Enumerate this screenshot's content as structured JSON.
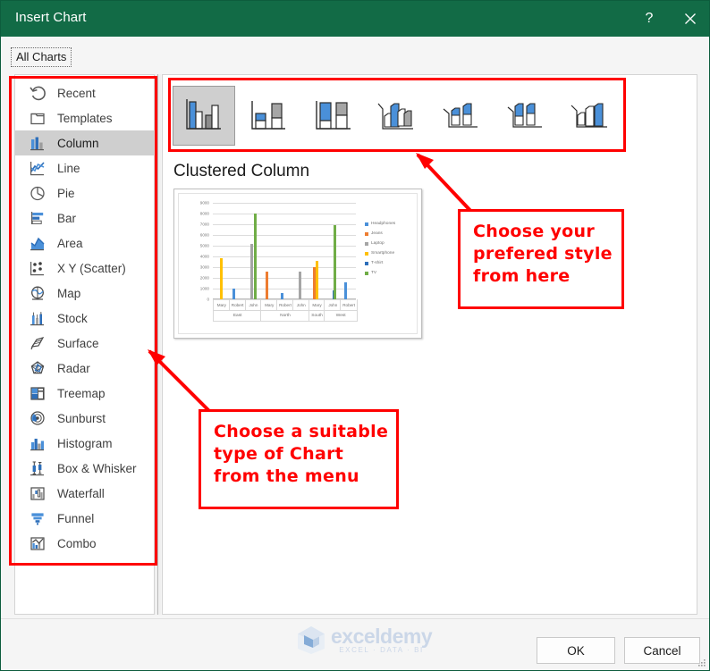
{
  "window": {
    "title": "Insert Chart",
    "help_icon": "question-mark-icon",
    "help_label": "?",
    "close_icon": "close-icon",
    "accent_color": "#126b46",
    "annotation_color": "#ff0000"
  },
  "tabs": {
    "all_charts_label": "All Charts"
  },
  "chart_types": {
    "selected": "Column",
    "items": [
      {
        "label": "Recent",
        "icon": "recent-undo-icon"
      },
      {
        "label": "Templates",
        "icon": "templates-folder-icon"
      },
      {
        "label": "Column",
        "icon": "column-chart-icon"
      },
      {
        "label": "Line",
        "icon": "line-chart-icon"
      },
      {
        "label": "Pie",
        "icon": "pie-chart-icon"
      },
      {
        "label": "Bar",
        "icon": "bar-chart-icon"
      },
      {
        "label": "Area",
        "icon": "area-chart-icon"
      },
      {
        "label": "X Y (Scatter)",
        "icon": "scatter-chart-icon"
      },
      {
        "label": "Map",
        "icon": "map-chart-icon"
      },
      {
        "label": "Stock",
        "icon": "stock-chart-icon"
      },
      {
        "label": "Surface",
        "icon": "surface-chart-icon"
      },
      {
        "label": "Radar",
        "icon": "radar-chart-icon"
      },
      {
        "label": "Treemap",
        "icon": "treemap-chart-icon"
      },
      {
        "label": "Sunburst",
        "icon": "sunburst-chart-icon"
      },
      {
        "label": "Histogram",
        "icon": "histogram-chart-icon"
      },
      {
        "label": "Box & Whisker",
        "icon": "box-whisker-chart-icon"
      },
      {
        "label": "Waterfall",
        "icon": "waterfall-chart-icon"
      },
      {
        "label": "Funnel",
        "icon": "funnel-chart-icon"
      },
      {
        "label": "Combo",
        "icon": "combo-chart-icon"
      }
    ]
  },
  "subtypes": {
    "selected_index": 0,
    "items": [
      {
        "name": "Clustered Column",
        "icon": "clustered-column-icon"
      },
      {
        "name": "Stacked Column",
        "icon": "stacked-column-icon"
      },
      {
        "name": "100% Stacked Column",
        "icon": "100-stacked-column-icon"
      },
      {
        "name": "3-D Clustered Column",
        "icon": "3d-clustered-column-icon"
      },
      {
        "name": "3-D Stacked Column",
        "icon": "3d-stacked-column-icon"
      },
      {
        "name": "3-D 100% Stacked Column",
        "icon": "3d-100-stacked-column-icon"
      },
      {
        "name": "3-D Column",
        "icon": "3d-column-icon"
      }
    ]
  },
  "preview": {
    "title": "Clustered Column"
  },
  "chart_data": {
    "type": "bar",
    "title": "Clustered Column",
    "xlabel": "",
    "ylabel": "",
    "ylim": [
      0,
      9000
    ],
    "yticks": [
      "0",
      "1000",
      "2000",
      "3000",
      "4000",
      "5000",
      "6000",
      "7000",
      "8000",
      "9000"
    ],
    "grid": true,
    "legend_position": "right",
    "legend": [
      "Headphones",
      "Jeans",
      "Laptop",
      "Smartphone",
      "T-shirt",
      "TV"
    ],
    "series_colors": [
      "#4a90d9",
      "#ed7d31",
      "#a5a5a5",
      "#ffc000",
      "#2e6fba",
      "#70ad47"
    ],
    "groups": [
      {
        "region": "East",
        "people": [
          "Mary",
          "Robert",
          "John"
        ]
      },
      {
        "region": "North",
        "people": [
          "Mary",
          "Robert",
          "John"
        ]
      },
      {
        "region": "South",
        "people": [
          "Mary"
        ]
      },
      {
        "region": "West",
        "people": [
          "John",
          "Robert"
        ]
      }
    ],
    "categories": [
      "East / Mary",
      "East / Robert",
      "East / John",
      "North / Mary",
      "North / Robert",
      "North / John",
      "South / Mary",
      "West / John",
      "West / Robert"
    ],
    "series": [
      {
        "name": "Headphones",
        "values": [
          0,
          1020,
          0,
          0,
          560,
          0,
          0,
          0,
          1550
        ]
      },
      {
        "name": "Jeans",
        "values": [
          0,
          0,
          0,
          2570,
          0,
          0,
          2980,
          0,
          0
        ]
      },
      {
        "name": "Laptop",
        "values": [
          0,
          0,
          5130,
          0,
          0,
          2560,
          0,
          0,
          0
        ]
      },
      {
        "name": "Smartphone",
        "values": [
          3800,
          0,
          0,
          0,
          0,
          0,
          3580,
          0,
          0
        ]
      },
      {
        "name": "T-shirt",
        "values": [
          0,
          0,
          0,
          0,
          0,
          0,
          0,
          810,
          0
        ]
      },
      {
        "name": "TV",
        "values": [
          0,
          0,
          8000,
          0,
          0,
          0,
          0,
          6950,
          0
        ]
      }
    ]
  },
  "annotations": [
    {
      "id": "style-callout",
      "text_lines": [
        "Choose your",
        "prefered style",
        "from here"
      ]
    },
    {
      "id": "type-callout",
      "text_lines": [
        "Choose a suitable",
        "type of Chart",
        "from the menu"
      ]
    }
  ],
  "watermark": {
    "name": "exceldemy",
    "tagline": "EXCEL · DATA · BI"
  },
  "footer": {
    "ok_label": "OK",
    "cancel_label": "Cancel"
  }
}
